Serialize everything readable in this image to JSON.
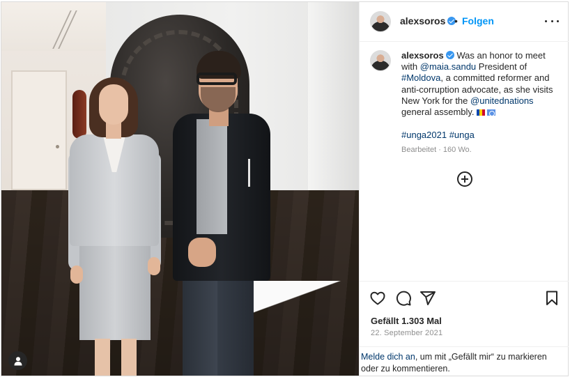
{
  "post": {
    "author": {
      "username": "alexsoros",
      "verified": true
    },
    "header": {
      "separator": "•",
      "follow_label": "Folgen",
      "more_icon": "more-horizontal-icon"
    },
    "caption": {
      "username": "alexsoros",
      "segment_1": "Was an honor to meet with",
      "mention_1": "@maia.sandu",
      "segment_2": "President of",
      "hashtag_1": "#Moldova",
      "segment_3": ", a committed reformer and anti-corruption advocate, as she visits New York for the",
      "mention_2": "@unitednations",
      "segment_4": "general assembly.",
      "flags": [
        "moldova-flag",
        "united-nations-flag"
      ],
      "hashtags": [
        "#unga2021",
        "#unga"
      ],
      "edited_meta": "Bearbeitet · 160 Wo.",
      "add_icon": "add-circle-icon"
    },
    "actions": {
      "icons": [
        "heart-icon",
        "comment-icon",
        "share-icon",
        "bookmark-icon"
      ],
      "likes_text": "Gefällt 1.303 Mal",
      "date_text": "22. September 2021"
    },
    "login_prompt": {
      "link_text": "Melde dich an",
      "rest_text": ", um mit „Gefällt mir“ zu markieren oder zu kommentieren."
    },
    "photo": {
      "tag_icon": "user-tag-icon"
    },
    "colors": {
      "link": "#00376b",
      "follow": "#0095f6",
      "verified": "#3897f0",
      "muted": "#8e8e8e",
      "text": "#262626"
    }
  }
}
